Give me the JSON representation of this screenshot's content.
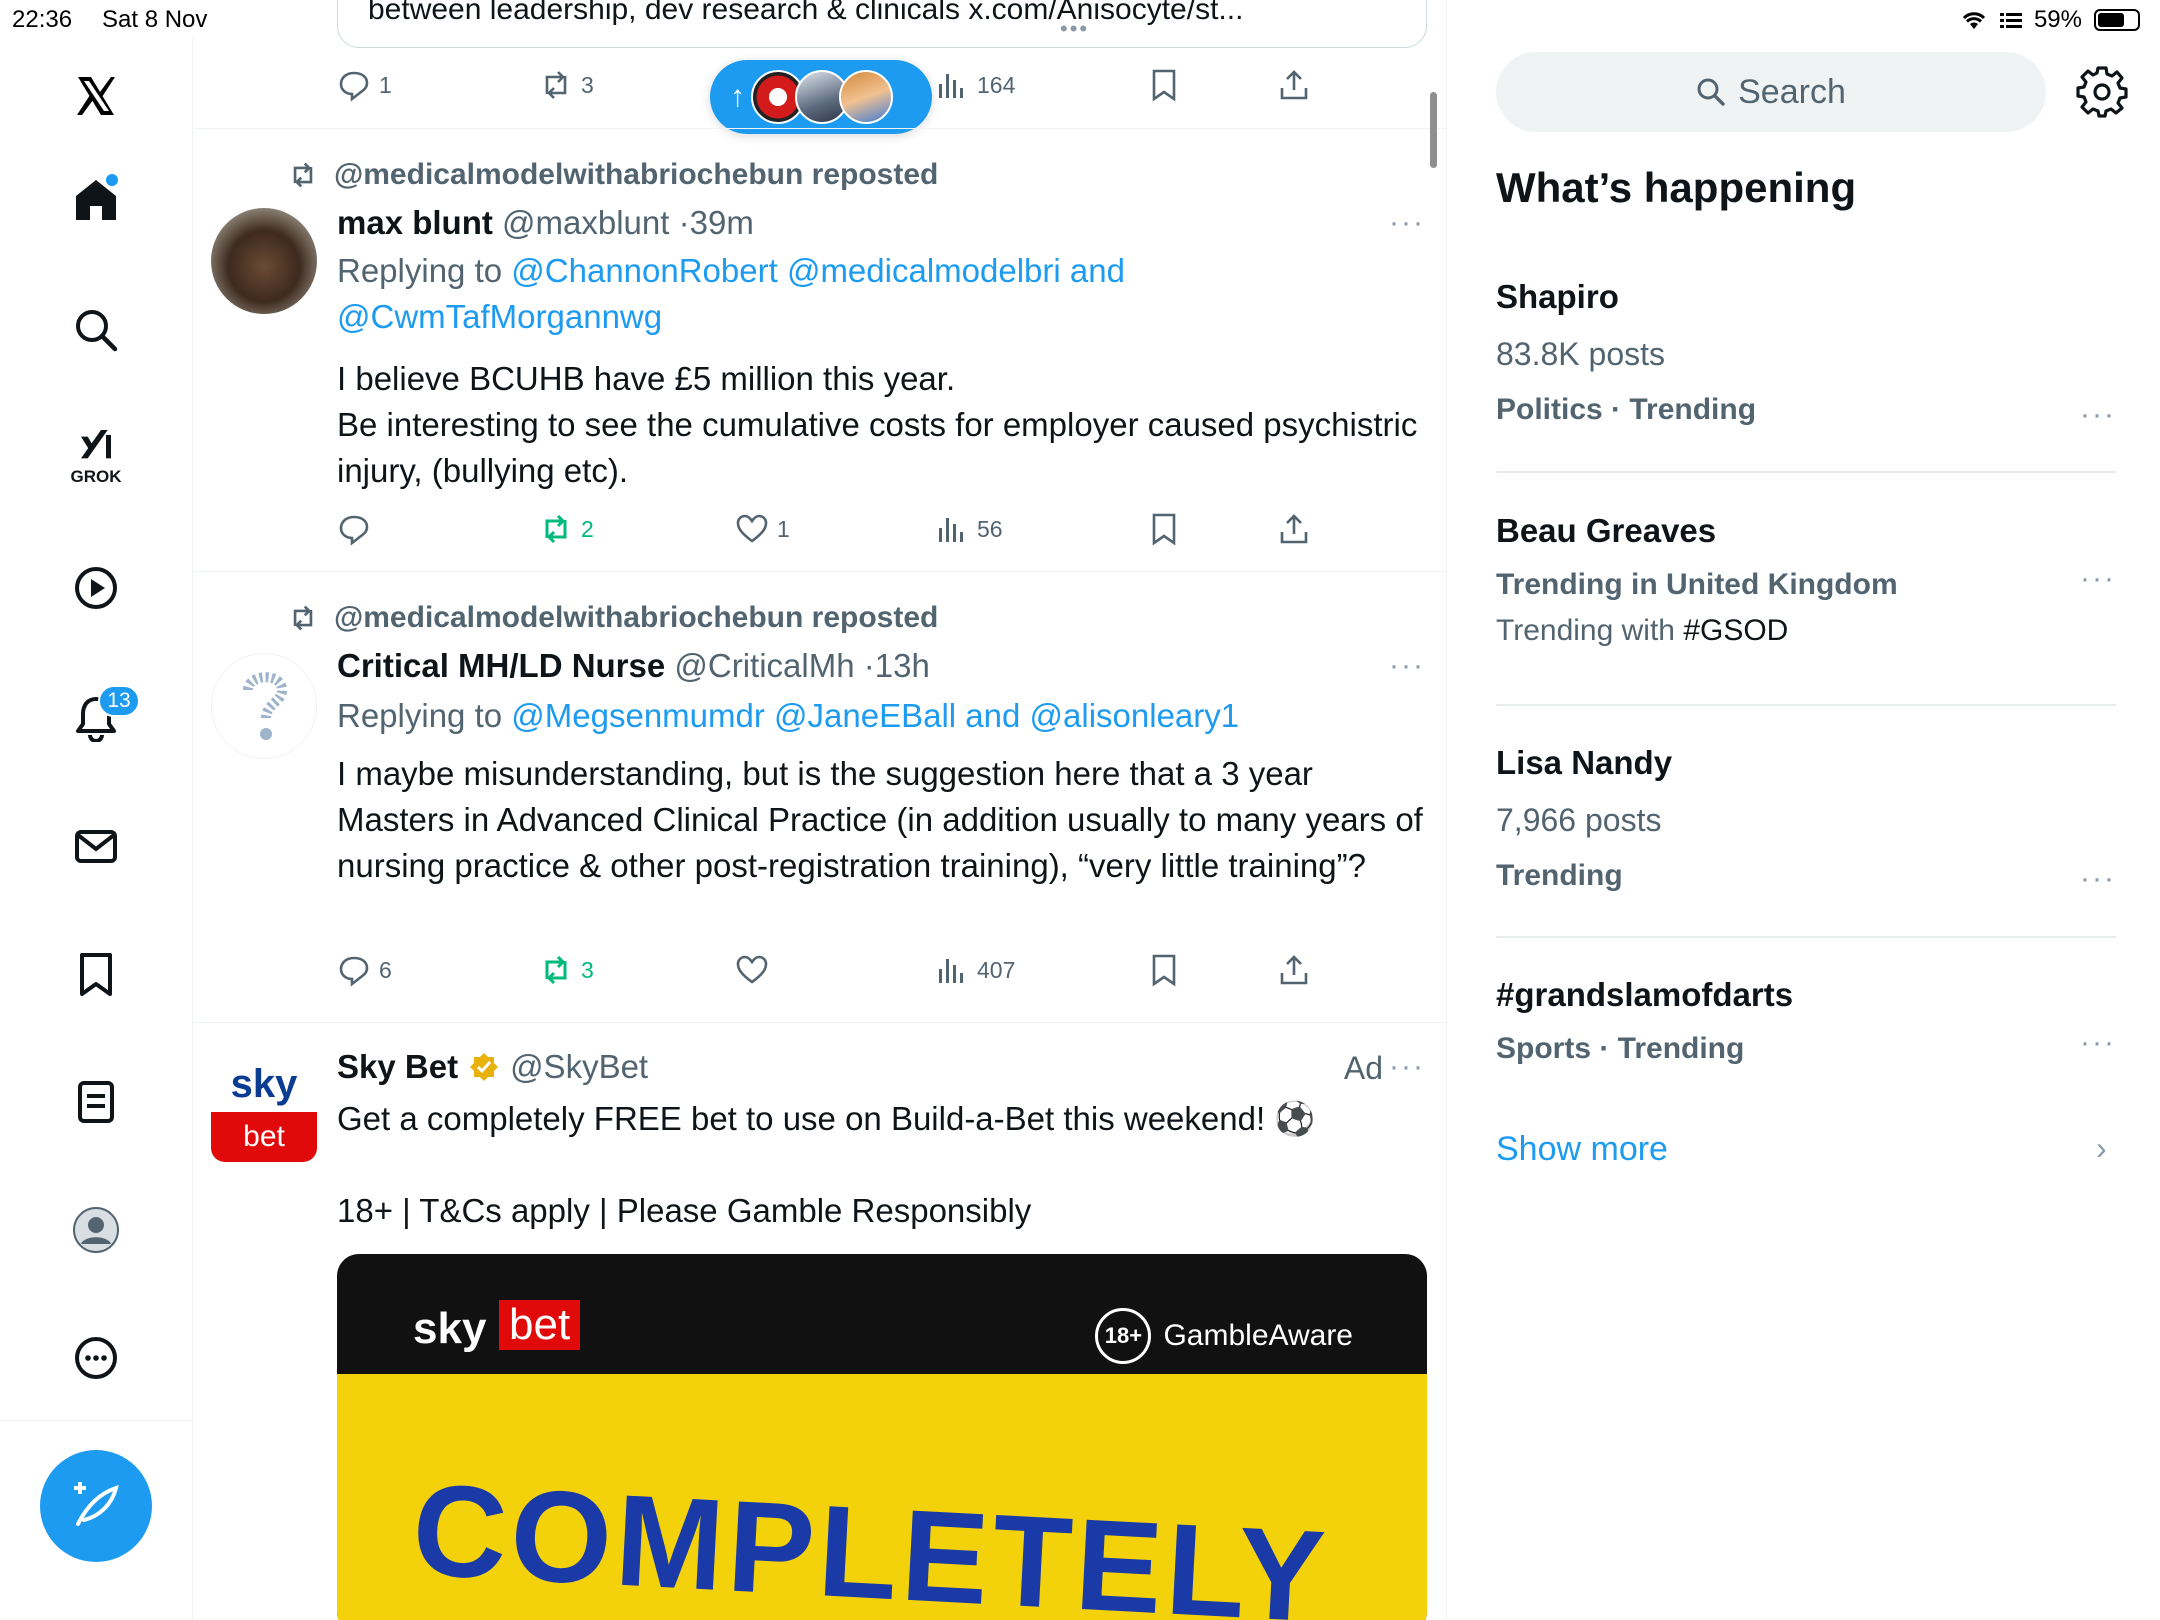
{
  "status": {
    "time": "22:36",
    "date": "Sat 8 Nov",
    "battery": "59%"
  },
  "nav": {
    "grok_label": "GROK",
    "notifications_badge": "13"
  },
  "prev_tweet": {
    "text_fragment": "between leadership, dev research & clinicals x.com/Anisocyte/st...",
    "actions": {
      "replies": "1",
      "reposts": "3",
      "views": "164"
    }
  },
  "new_posts_pill": {
    "arrow": "↑"
  },
  "tweets": [
    {
      "repost_by": "@medicalmodelwithabriochebun reposted",
      "name": "max blunt",
      "handle": "@maxblunt",
      "dot": "·",
      "time": "39m",
      "replying_prefix": "Replying to",
      "replying_to": "@ChannonRobert @medicalmodelbri and @CwmTafMorgannwg",
      "body": "I believe BCUHB have £5 million this year.\nBe interesting to see the cumulative costs for employer caused psychistric injury, (bullying etc).",
      "actions": {
        "replies": "",
        "reposts": "2",
        "likes": "1",
        "views": "56"
      }
    },
    {
      "repost_by": "@medicalmodelwithabriochebun reposted",
      "name": "Critical MH/LD Nurse",
      "handle": "@CriticalMh",
      "dot": "·",
      "time": "13h",
      "replying_prefix": "Replying to",
      "replying_to": "@Megsenmumdr @JaneEBall and @alisonleary1",
      "body": "I maybe misunderstanding, but is the suggestion here that a 3 year Masters in Advanced Clinical Practice (in addition usually to many years of nursing practice & other post-registration training), “very little training”?",
      "actions": {
        "replies": "6",
        "reposts": "3",
        "likes": "",
        "views": "407"
      }
    }
  ],
  "ad": {
    "name": "Sky Bet",
    "handle": "@SkyBet",
    "ad_label": "Ad",
    "avatar_sky": "sky",
    "avatar_bet": "bet",
    "line1": "Get a completely FREE bet to use on Build-a-Bet this weekend! ⚽",
    "line2": "18+ | T&Cs apply | Please Gamble Responsibly",
    "image": {
      "sky": "sky",
      "bet": "bet",
      "age": "18+",
      "gamble": "GambleAware",
      "headline": "COMPLETELY"
    }
  },
  "right": {
    "search_placeholder": "Search",
    "heading": "What’s happening",
    "trends": [
      {
        "title": "Shapiro",
        "sub": "83.8K posts",
        "meta": "Politics · Trending"
      },
      {
        "title": "Beau Greaves",
        "meta": "Trending in United Kingdom",
        "sub_prefix": "Trending with ",
        "sub_tag": "#GSOD"
      },
      {
        "title": "Lisa Nandy",
        "sub": "7,966 posts",
        "meta": "Trending"
      },
      {
        "title": "#grandslamofdarts",
        "meta": "Sports · Trending"
      }
    ],
    "show_more": "Show more",
    "more_glyph": "···",
    "chevron": "›"
  },
  "colors": {
    "accent": "#1d9bf0",
    "repost_green": "#00ba7c",
    "muted": "#536471"
  }
}
